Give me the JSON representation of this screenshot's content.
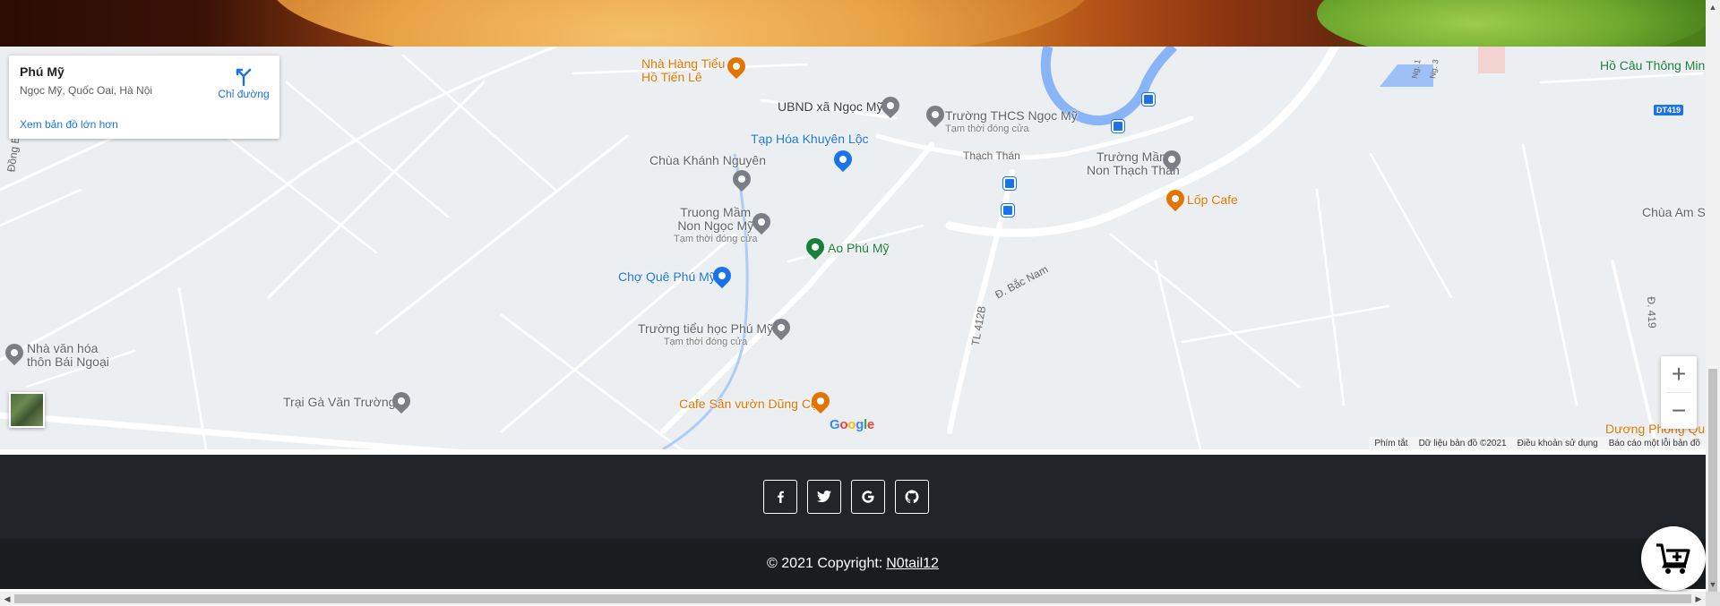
{
  "map": {
    "place_card": {
      "title": "Phú Mỹ",
      "address": "Ngọc Mỹ, Quốc Oai, Hà Nội",
      "directions_label": "Chỉ đường",
      "larger_map_label": "Xem bản đồ lớn hơn"
    },
    "pois": [
      {
        "name": "Nhà Hàng Tiểu\nHồ Tiến Lê",
        "color": "#e37400"
      },
      {
        "name": "UBND xã Ngọc Mỹ",
        "color": "#3c4043"
      },
      {
        "name": "Trường THCS Ngọc Mỹ",
        "sub": "Tạm thời đóng cửa",
        "color": "#5f6368"
      },
      {
        "name": "Tạp Hóa Khuyên Lộc",
        "color": "#1a73e8"
      },
      {
        "name": "Chùa Khánh Nguyên",
        "color": "#5f6368"
      },
      {
        "name": "Trường Mầm\nNon Thạch Thán",
        "color": "#5f6368"
      },
      {
        "name": "Lốp Cafe",
        "color": "#e37400"
      },
      {
        "name": "Truong Mầm\nNon Ngọc Mỹ",
        "sub": "Tạm thời đóng cửa",
        "color": "#5f6368"
      },
      {
        "name": "Ao Phú Mỹ",
        "color": "#188038"
      },
      {
        "name": "Chợ Quê Phú Mỹ",
        "color": "#1a73e8"
      },
      {
        "name": "Trường tiểu học Phú Mỹ",
        "sub": "Tạm thời đóng cửa",
        "color": "#5f6368"
      },
      {
        "name": "Nhà văn hóa\nthôn Bái Ngoại",
        "color": "#5f6368"
      },
      {
        "name": "Trại Gà Văn Trường",
        "color": "#5f6368"
      },
      {
        "name": "Cafe Sân vườn Dũng Cọ",
        "color": "#e37400"
      },
      {
        "name": "Hồ Câu Thông Minh",
        "color": "#188038"
      },
      {
        "name": "Chùa Am S",
        "color": "#5f6368"
      },
      {
        "name": "Dương Phong Quá",
        "color": "#e37400"
      }
    ],
    "road_labels": [
      "Thạch Thán",
      "Đ. Bắc Nam",
      "TL 412B",
      "Đ. 419",
      "Đồng Bụ",
      "Ng. 1",
      "Ng. 3"
    ],
    "road_tag": "DT419",
    "zoom_in": "+",
    "zoom_out": "−",
    "google_logo": [
      "G",
      "o",
      "o",
      "g",
      "l",
      "e"
    ],
    "attribution": [
      "Phím tắt",
      "Dữ liệu bản đồ ©2021",
      "Điều khoản sử dụng",
      "Báo cáo một lỗi bản đồ"
    ]
  },
  "footer": {
    "socials": [
      {
        "name": "facebook-icon"
      },
      {
        "name": "twitter-icon"
      },
      {
        "name": "google-icon"
      },
      {
        "name": "github-icon"
      }
    ],
    "copyright_text": "© 2021 Copyright:",
    "copyright_link": "N0tail12"
  },
  "colors": {
    "footer_bg": "#212529",
    "map_bg": "#eceff1",
    "accent_blue": "#1a73e8"
  }
}
